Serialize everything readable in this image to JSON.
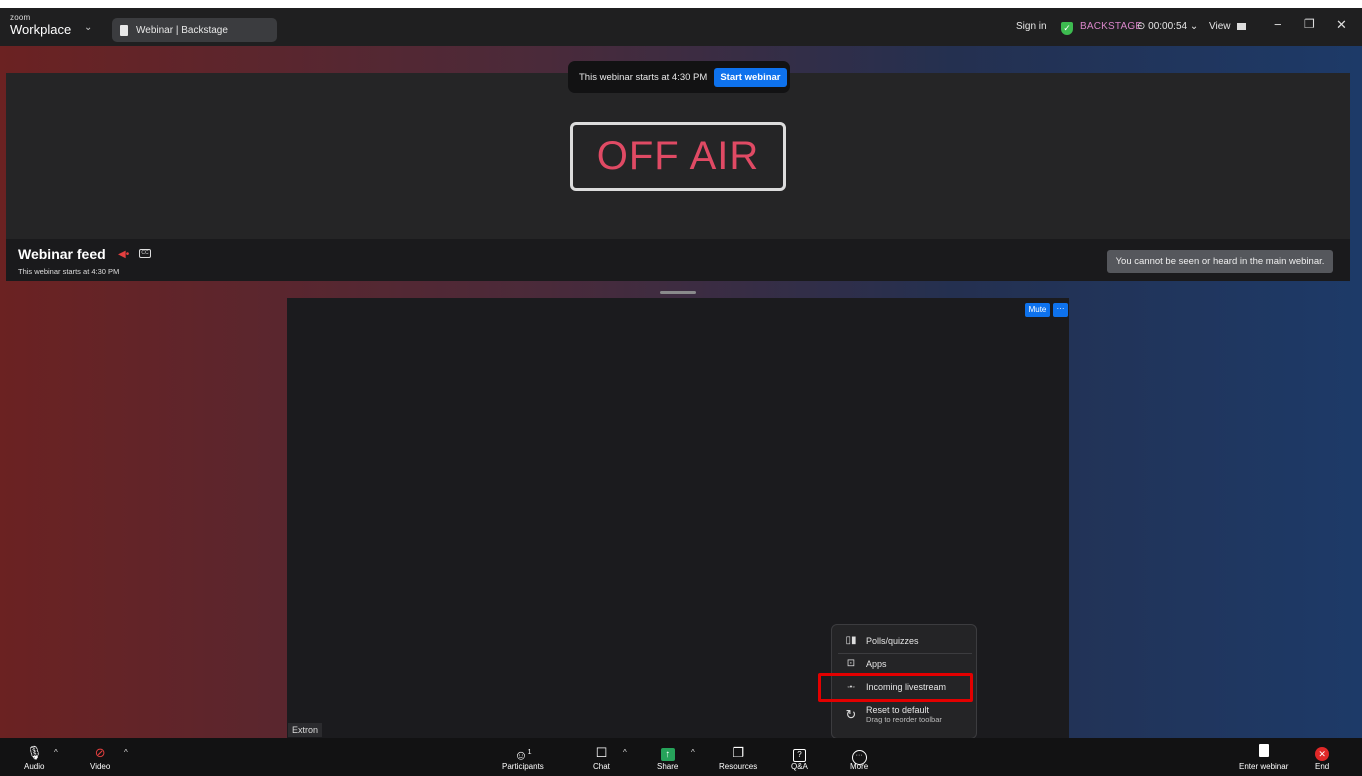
{
  "app": {
    "brand_top": "zoom",
    "brand_bottom": "Workplace"
  },
  "tab": {
    "title": "Webinar | Backstage"
  },
  "header": {
    "sign_in": "Sign in",
    "status": "BACKSTAGE",
    "timer": "⊙ 00:00:54 ⌄",
    "view": "View"
  },
  "banner": {
    "text": "This webinar starts at 4:30 PM",
    "start_button": "Start webinar"
  },
  "feed": {
    "off_air": "OFF AIR",
    "title": "Webinar feed",
    "subtitle": "This webinar starts at 4:30 PM",
    "cc_label": "CC",
    "notice": "You cannot be seen or heard in the main webinar."
  },
  "video": {
    "mute": "Mute",
    "more": "···",
    "name": "Extron"
  },
  "more_menu": {
    "items": [
      {
        "icon": "polls-icon",
        "glyph": "▯▮",
        "label": "Polls/quizzes"
      },
      {
        "icon": "apps-icon",
        "glyph": "⊡",
        "label": "Apps"
      },
      {
        "icon": "livestream-icon",
        "glyph": "◦•◦",
        "label": "Incoming livestream"
      }
    ],
    "reset": {
      "label": "Reset to default",
      "sublabel": "Drag to reorder toolbar"
    }
  },
  "toolbar": {
    "audio": "Audio",
    "video": "Video",
    "participants": "Participants",
    "participants_count": "1",
    "chat": "Chat",
    "share": "Share",
    "resources": "Resources",
    "qa": "Q&A",
    "more": "More",
    "enter_webinar": "Enter webinar",
    "end": "End"
  },
  "colors": {
    "accent": "#0e72ed",
    "off_air": "#e04a64",
    "backstage": "#d985c9",
    "highlight": "#e30000",
    "shield": "#3dbb50"
  }
}
